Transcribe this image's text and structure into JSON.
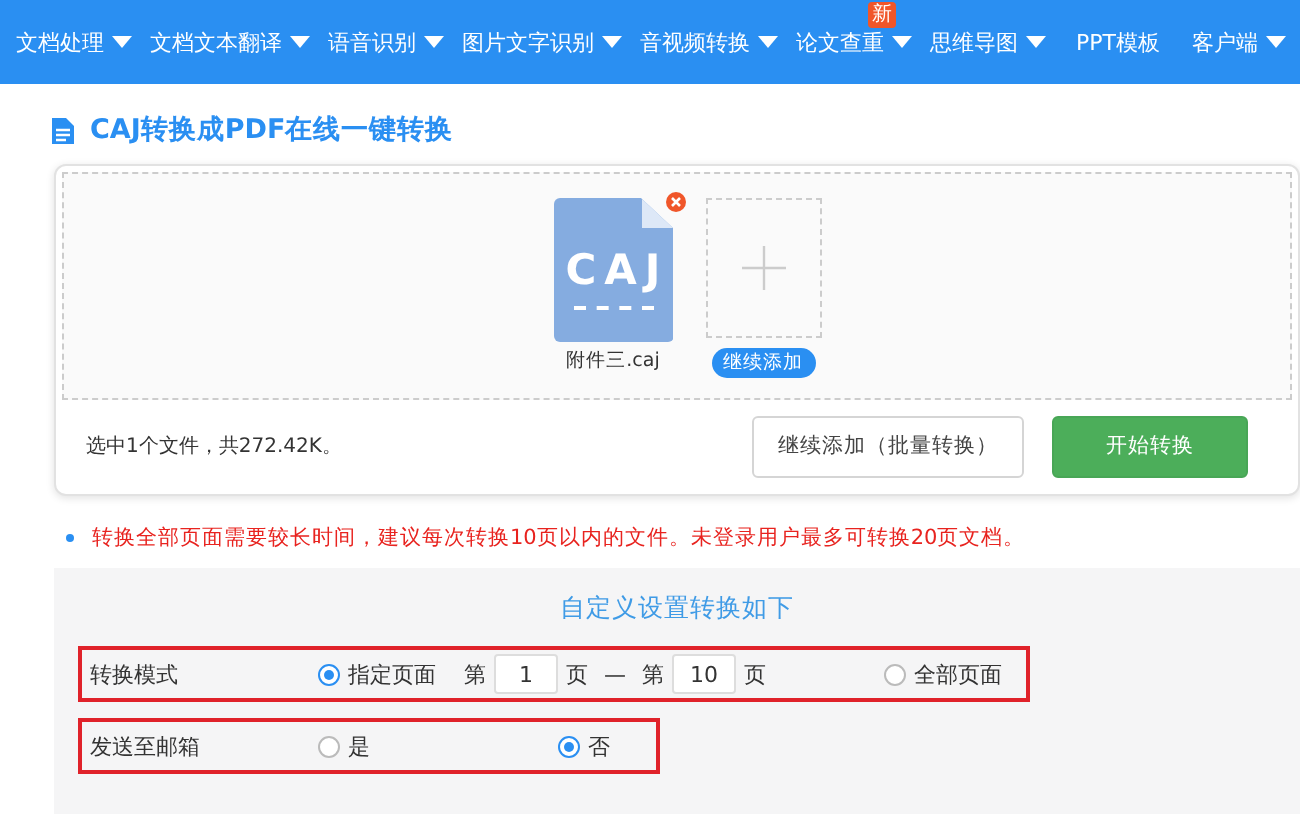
{
  "nav": {
    "items": [
      {
        "label": "文档处理",
        "has_menu": true
      },
      {
        "label": "文档文本翻译",
        "has_menu": true
      },
      {
        "label": "语音识别",
        "has_menu": true
      },
      {
        "label": "图片文字识别",
        "has_menu": true
      },
      {
        "label": "音视频转换",
        "has_menu": true
      },
      {
        "label": "论文查重",
        "has_menu": true,
        "badge": "新"
      },
      {
        "label": "思维导图",
        "has_menu": true
      },
      {
        "label": "PPT模板",
        "has_menu": false
      },
      {
        "label": "客户端",
        "has_menu": true
      }
    ]
  },
  "page_title": "CAJ转换成PDF在线一键转换",
  "upload": {
    "files": [
      {
        "type_label": "CAJ",
        "name": "附件三.caj"
      }
    ],
    "add_tile": {
      "label": "继续添加"
    },
    "summary": "选中1个文件，共272.42K。",
    "buttons": [
      {
        "label": "继续添加（批量转换）",
        "kind": "secondary"
      },
      {
        "label": "开始转换",
        "kind": "primary"
      }
    ]
  },
  "notice": "转换全部页面需要较长时间，建议每次转换10页以内的文件。未登录用户最多可转换20页文档。",
  "settings": {
    "heading": "自定义设置转换如下",
    "conversion_mode": {
      "label": "转换模式",
      "options": [
        {
          "label": "指定页面",
          "selected": true
        },
        {
          "label": "全部页面",
          "selected": false
        }
      ],
      "range": {
        "from_prefix": "第",
        "from_value": "1",
        "from_suffix": "页",
        "dash": "—",
        "to_prefix": "第",
        "to_value": "10",
        "to_suffix": "页"
      }
    },
    "send_email": {
      "label": "发送至邮箱",
      "options": [
        {
          "label": "是",
          "selected": false
        },
        {
          "label": "否",
          "selected": true
        }
      ]
    }
  }
}
